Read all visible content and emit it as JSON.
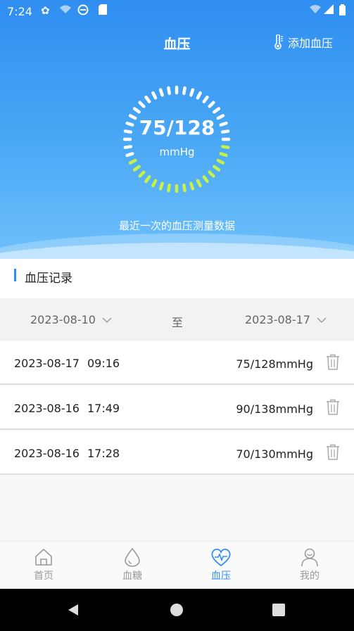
{
  "status_bar": {
    "time": "7:24"
  },
  "header": {
    "title": "血压",
    "add_button": "添加血压"
  },
  "latest": {
    "value": "75/128",
    "unit": "mmHg",
    "caption": "最近一次的血压测量数据"
  },
  "records_section": {
    "title": "血压记录"
  },
  "date_range": {
    "start": "2023-08-10",
    "separator": "至",
    "end": "2023-08-17"
  },
  "records": [
    {
      "date": "2023-08-17",
      "time": "09:16",
      "value": "75/128mmHg"
    },
    {
      "date": "2023-08-16",
      "time": "17:49",
      "value": "90/138mmHg"
    },
    {
      "date": "2023-08-16",
      "time": "17:28",
      "value": "70/130mmHg"
    }
  ],
  "tabs": [
    {
      "label": "首页",
      "icon": "home-icon"
    },
    {
      "label": "血糖",
      "icon": "drop-icon"
    },
    {
      "label": "血压",
      "icon": "heart-pulse-icon",
      "active": true
    },
    {
      "label": "我的",
      "icon": "person-icon"
    }
  ],
  "colors": {
    "primary": "#2f8ef0",
    "dial_green": "#c8f04a"
  }
}
